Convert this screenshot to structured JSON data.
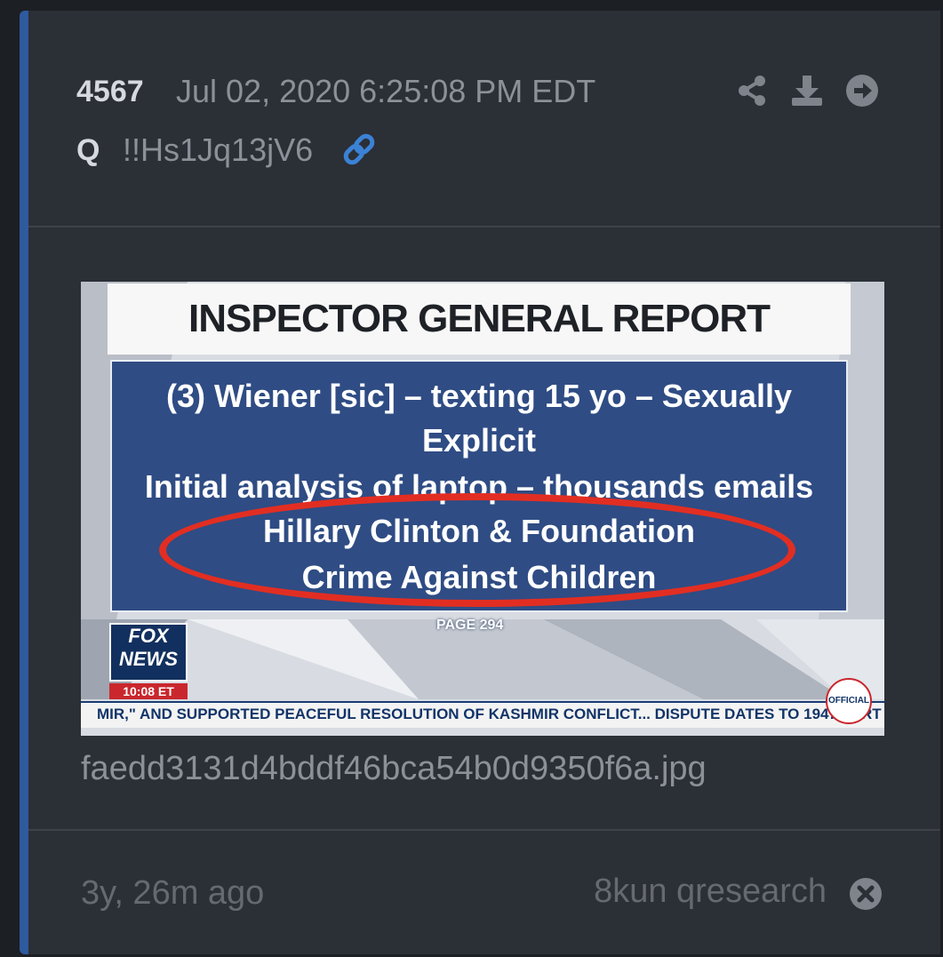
{
  "post": {
    "number": "4567",
    "date": "Jul 02, 2020 6:25:08 PM EDT",
    "author": "Q",
    "tripcode": "!!Hs1Jq13jV6",
    "icons": [
      "share-icon",
      "download-icon",
      "arrow-right-circle-icon",
      "link-icon"
    ]
  },
  "attachment": {
    "title": "INSPECTOR GENERAL REPORT",
    "lines": [
      "(3) Wiener [sic] – texting 15 yo – Sexually",
      "Explicit",
      "Initial analysis of laptop – thousands emails",
      "Hillary Clinton & Foundation",
      "Crime Against Children"
    ],
    "page_label": "PAGE 294",
    "logo_line1": "FOX",
    "logo_line2": "NEWS",
    "time": "10:08 ET",
    "ticker": "MIR,\" AND SUPPORTED PEACEFUL RESOLUTION OF KASHMIR CONFLICT...  DISPUTE DATES TO 1947 PART",
    "badge": "OFFICIAL",
    "filename": "faedd3131d4bddf46bca54b0d9350f6a.jpg"
  },
  "footer": {
    "age": "3y, 26m ago",
    "source": "8kun qresearch"
  },
  "colors": {
    "card_bg": "#2b2f36",
    "accent": "#2e5a9e",
    "link": "#3b82d6",
    "panel_blue": "#2f4c84",
    "highlight_red": "#e22e22"
  }
}
